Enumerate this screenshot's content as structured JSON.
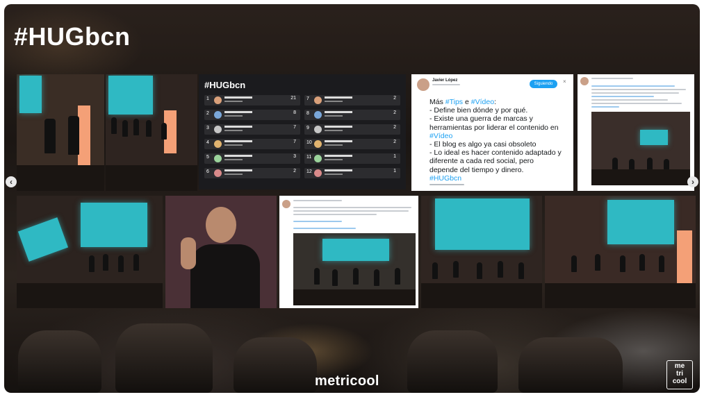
{
  "title": "#HUGbcn",
  "brand": "metricool",
  "brand_logo": "me\ntri\ncool",
  "nav": {
    "prev_icon": "chevron-left-icon",
    "next_icon": "chevron-right-icon",
    "prev_label": "‹",
    "next_label": "›"
  },
  "leaderboard": {
    "title": "#HUGbcn",
    "left_rows": [
      {
        "rank": "1",
        "value": "21"
      },
      {
        "rank": "2",
        "value": "8"
      },
      {
        "rank": "3",
        "value": "7"
      },
      {
        "rank": "4",
        "value": "7"
      },
      {
        "rank": "5",
        "value": "3"
      },
      {
        "rank": "6",
        "value": "2"
      }
    ],
    "right_rows": [
      {
        "rank": "7",
        "value": "2"
      },
      {
        "rank": "8",
        "value": "2"
      },
      {
        "rank": "9",
        "value": "2"
      },
      {
        "rank": "10",
        "value": "2"
      },
      {
        "rank": "11",
        "value": "1"
      },
      {
        "rank": "12",
        "value": "1"
      }
    ]
  },
  "tweet_main": {
    "author": "Javier López",
    "follow_label": "Siguiendo",
    "lines": [
      {
        "plain": "Más ",
        "tag1": "#Tips",
        "mid": " e ",
        "tag2": "#Vídeo",
        "end": ":"
      },
      {
        "plain": "- Define bien dónde y por qué."
      },
      {
        "plain": "- Existe una guerra de marcas y"
      },
      {
        "plain": "herramientas por liderar el contenido en"
      },
      {
        "tag1": "#Vídeo"
      },
      {
        "plain": "- El blog es algo ya casi obsoleto"
      },
      {
        "plain": "- Lo ideal es hacer contenido adaptado y"
      },
      {
        "plain": "diferente a cada red social, pero"
      },
      {
        "plain": "depende del tiempo y dinero."
      },
      {
        "tag1": "#HUGbcn"
      }
    ]
  },
  "colors": {
    "accent": "#1da1f2",
    "screen": "#2fb9c3",
    "banner": "#f4a077"
  }
}
